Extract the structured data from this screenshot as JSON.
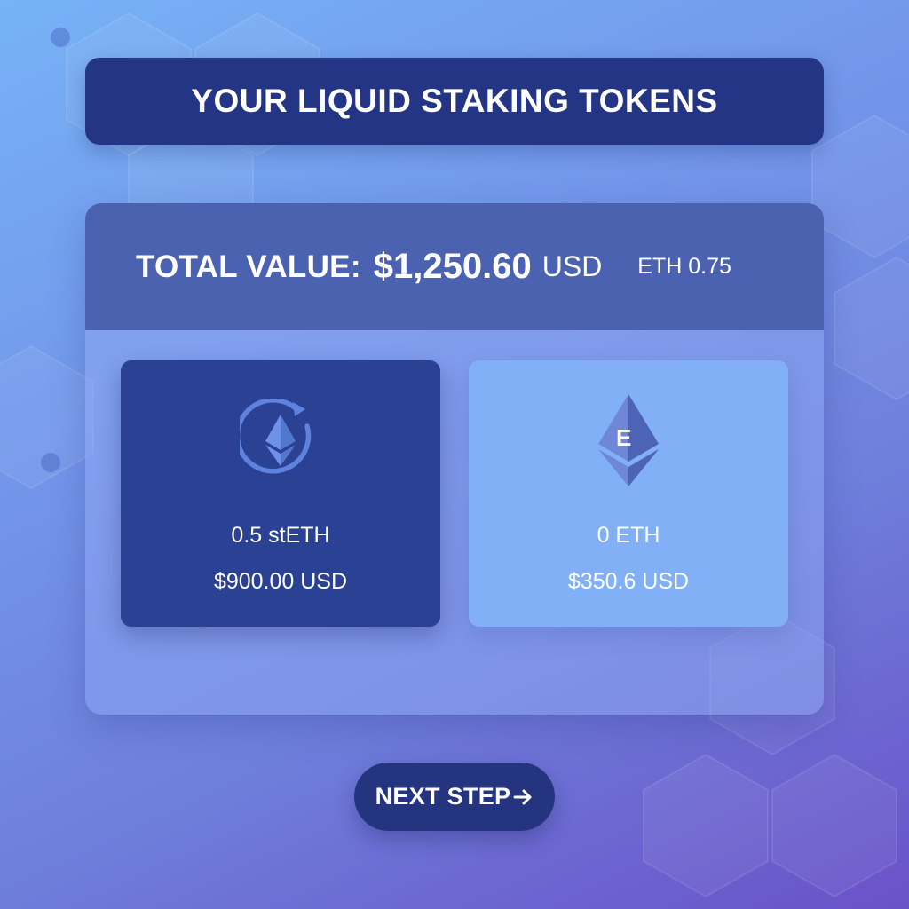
{
  "header": {
    "title": "YOUR LIQUID STAKING TOKENS"
  },
  "summary": {
    "label": "TOTAL VALUE:",
    "value": "$1,250.60",
    "currency": "USD",
    "eth_total": "ETH 0.75"
  },
  "tokens": [
    {
      "amount": "0.5 stETH",
      "usd_value": "$900.00 USD",
      "icon": "steth-icon"
    },
    {
      "amount": "0 ETH",
      "usd_value": "$350.6 USD",
      "icon": "eth-icon",
      "icon_letter": "E"
    }
  ],
  "actions": {
    "next_label": "NEXT STEP",
    "next_icon": "arrow-right-icon"
  },
  "colors": {
    "banner": "#233584",
    "panel_header": "#4a62b0",
    "steth_card": "#2b4193",
    "eth_card": "#82b0f6",
    "button": "#24347f"
  }
}
